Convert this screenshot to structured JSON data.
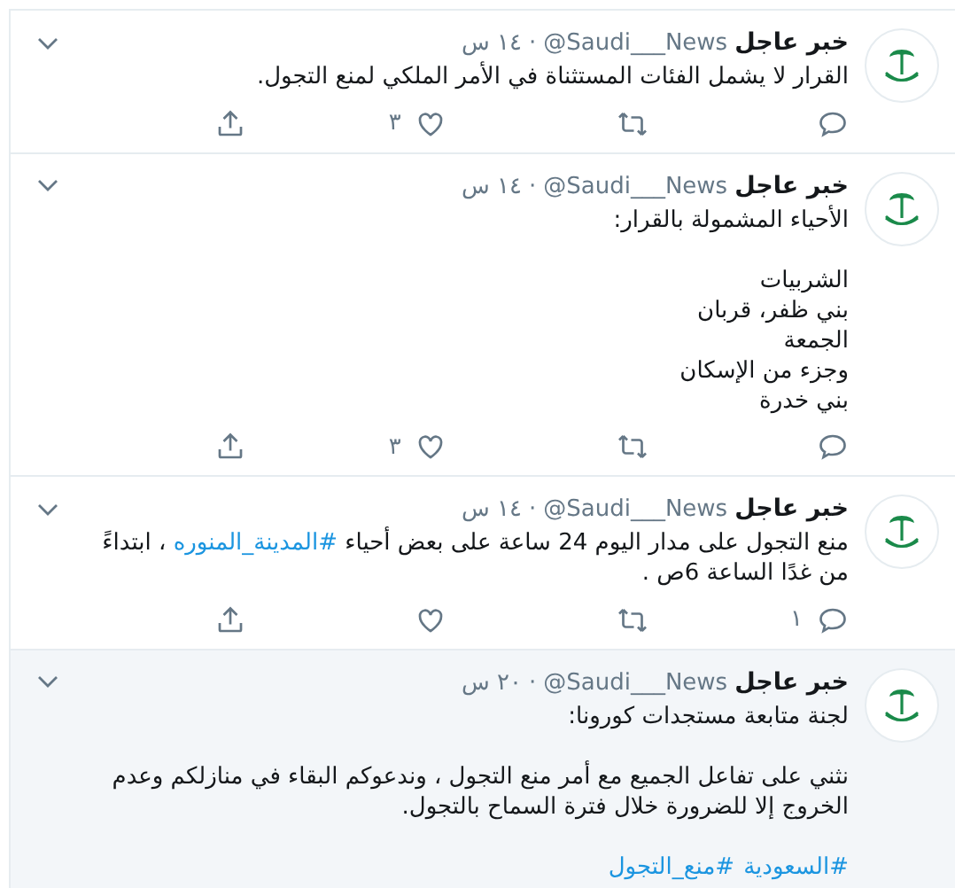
{
  "tweets": [
    {
      "name": "خبر عاجل",
      "handle": "@Saudi___News",
      "separator": "·",
      "time": "١٤ س",
      "highlighted": false,
      "body": [
        {
          "kind": "text",
          "text": "القرار لا يشمل الفئات المستثناة في الأمر الملكي لمنع التجول."
        }
      ],
      "actions": {
        "like_count": "٣"
      }
    },
    {
      "name": "خبر عاجل",
      "handle": "@Saudi___News",
      "separator": "·",
      "time": "١٤ س",
      "highlighted": false,
      "body": [
        {
          "kind": "text",
          "text": "الأحياء المشمولة بالقرار:\n\nالشربيات\nبني ظفر، قربان\nالجمعة\nوجزء من الإسكان\nبني خدرة"
        }
      ],
      "actions": {
        "like_count": "٣"
      }
    },
    {
      "name": "خبر عاجل",
      "handle": "@Saudi___News",
      "separator": "·",
      "time": "١٤ س",
      "highlighted": false,
      "body": [
        {
          "kind": "text",
          "text": "منع التجول على مدار اليوم 24 ساعة على بعض أحياء "
        },
        {
          "kind": "hashtag",
          "text": "#المدينة_المنوره"
        },
        {
          "kind": "text",
          "text": " ، ابتداءً من غدًا الساعة 6ص ."
        }
      ],
      "actions": {
        "reply_count": "١"
      }
    },
    {
      "name": "خبر عاجل",
      "handle": "@Saudi___News",
      "separator": "·",
      "time": "٢٠ س",
      "highlighted": true,
      "body": [
        {
          "kind": "text",
          "text": "لجنة متابعة مستجدات كورونا:\n\nنثني على تفاعل الجميع مع أمر منع التجول ، وندعوكم البقاء في منازلكم وعدم الخروج إلا للضرورة خلال فترة السماح بالتجول.\n\n"
        },
        {
          "kind": "hashtag",
          "text": "#السعودية"
        },
        {
          "kind": "hashtag",
          "text": "#منع_التجول"
        }
      ]
    }
  ]
}
